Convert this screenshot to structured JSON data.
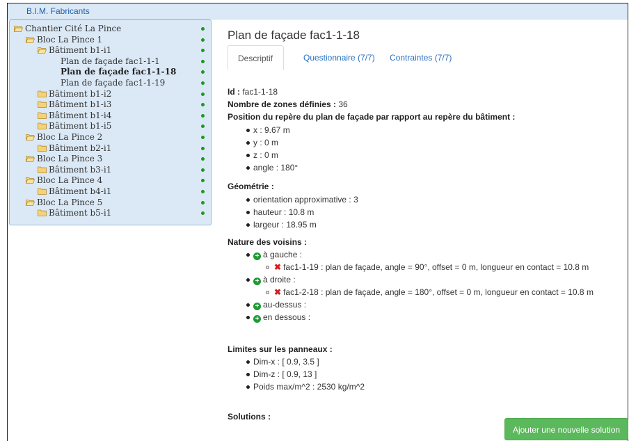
{
  "app": {
    "brand": "B.I.M. Fabricants"
  },
  "tree": [
    {
      "label": "Chantier Cité La Pince",
      "level": 0,
      "icon": "folder-open-icon"
    },
    {
      "label": "Bloc La Pince 1",
      "level": 1,
      "icon": "folder-open-icon"
    },
    {
      "label": "Bâtiment b1-i1",
      "level": 2,
      "icon": "folder-open-icon"
    },
    {
      "label": "Plan de façade fac1-1-1",
      "level": 3,
      "icon": ""
    },
    {
      "label": "Plan de façade fac1-1-18",
      "level": 3,
      "icon": "",
      "selected": true
    },
    {
      "label": "Plan de façade fac1-1-19",
      "level": 3,
      "icon": ""
    },
    {
      "label": "Bâtiment b1-i2",
      "level": 2,
      "icon": "folder-closed-icon"
    },
    {
      "label": "Bâtiment b1-i3",
      "level": 2,
      "icon": "folder-closed-icon"
    },
    {
      "label": "Bâtiment b1-i4",
      "level": 2,
      "icon": "folder-closed-icon"
    },
    {
      "label": "Bâtiment b1-i5",
      "level": 2,
      "icon": "folder-closed-icon"
    },
    {
      "label": "Bloc La Pince 2",
      "level": 1,
      "icon": "folder-open-icon"
    },
    {
      "label": "Bâtiment b2-i1",
      "level": 2,
      "icon": "folder-closed-icon"
    },
    {
      "label": "Bloc La Pince 3",
      "level": 1,
      "icon": "folder-open-icon"
    },
    {
      "label": "Bâtiment b3-i1",
      "level": 2,
      "icon": "folder-closed-icon"
    },
    {
      "label": "Bloc La Pince 4",
      "level": 1,
      "icon": "folder-open-icon"
    },
    {
      "label": "Bâtiment b4-i1",
      "level": 2,
      "icon": "folder-closed-icon"
    },
    {
      "label": "Bloc La Pince 5",
      "level": 1,
      "icon": "folder-open-icon"
    },
    {
      "label": "Bâtiment b5-i1",
      "level": 2,
      "icon": "folder-closed-icon"
    }
  ],
  "main": {
    "title": "Plan de façade fac1-1-18",
    "tabs": [
      {
        "label": "Descriptif",
        "active": true
      },
      {
        "label": "Questionnaire (7/7)",
        "active": false
      },
      {
        "label": "Contraintes (7/7)",
        "active": false
      }
    ],
    "id_label": "Id :",
    "id_value": " fac1-1-18",
    "zones_label": "Nombre de zones définies :",
    "zones_value": " 36",
    "position_heading": "Position du repère du plan de façade par rapport au repère du bâtiment :",
    "position_items": [
      "x : 9.67 m",
      "y : 0 m",
      "z : 0 m",
      "angle : 180°"
    ],
    "geometry_heading": "Géométrie :",
    "geometry_items": [
      "orientation approximative : 3",
      "hauteur : 10.8 m",
      "largeur : 18.95 m"
    ],
    "neighbors_heading": "Nature des voisins :",
    "neighbors": [
      {
        "label": "à gauche :",
        "children": [
          "fac1-1-19 : plan de façade, angle = 90°, offset = 0 m, longueur en contact = 10.8 m"
        ]
      },
      {
        "label": "à droite :",
        "children": [
          "fac1-2-18 : plan de façade, angle = 180°, offset = 0 m, longueur en contact = 10.8 m"
        ]
      },
      {
        "label": "au-dessus :",
        "children": []
      },
      {
        "label": "en dessous :",
        "children": []
      }
    ],
    "limits_heading": "Limites sur les panneaux :",
    "limits_items": [
      "Dim-x : [ 0.9, 3.5 ]",
      "Dim-z : [ 0.9, 13 ]",
      "Poids max/m^2 : 2530 kg/m^2"
    ],
    "solutions_heading": "Solutions :",
    "add_solution_label": "Ajouter une nouvelle solution"
  },
  "colors": {
    "topbar": "#dbe9f6",
    "tree_bg": "#dbe9f6",
    "link": "#2a6fc1",
    "status_dot": "#1a9a1a",
    "add_button": "#5cb85c",
    "remove_icon": "#d51c1c",
    "add_icon": "#1f9a33"
  }
}
